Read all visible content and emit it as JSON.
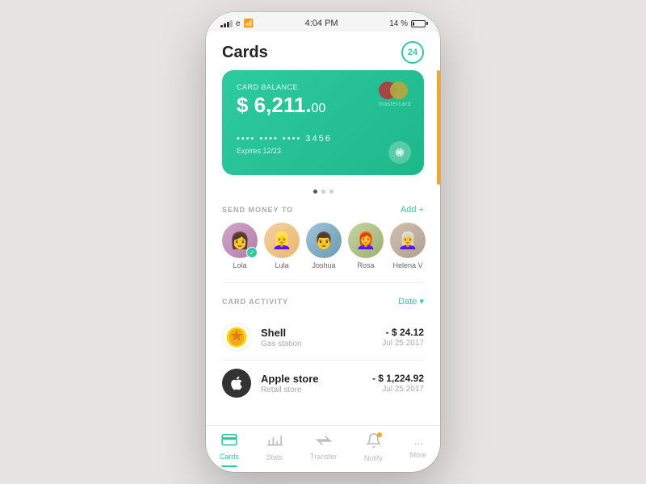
{
  "statusBar": {
    "time": "4:04 PM",
    "battery": "14 %",
    "carrier": "e"
  },
  "header": {
    "title": "Cards",
    "badge": "24"
  },
  "card": {
    "label": "Card balance",
    "balance": "$ 6,211.",
    "cents": "00",
    "cardNumber": "••••  ••••  ••••  3456",
    "expires": "Expires 12/23",
    "mastercardLabel": "mastercard"
  },
  "dots": [
    "active",
    "inactive",
    "inactive"
  ],
  "sendMoney": {
    "title": "SEND MONEY TO",
    "action": "Add +",
    "contacts": [
      {
        "name": "Lola",
        "face": "👩",
        "hasCheck": true
      },
      {
        "name": "Lula",
        "face": "👱‍♀️",
        "hasCheck": false
      },
      {
        "name": "Joshua",
        "face": "👨",
        "hasCheck": false
      },
      {
        "name": "Rosa",
        "face": "👩‍🦰",
        "hasCheck": false
      },
      {
        "name": "Helena V",
        "face": "👩‍🦳",
        "hasCheck": false
      }
    ]
  },
  "cardActivity": {
    "title": "CARD ACTIVITY",
    "filter": "Date ▾",
    "transactions": [
      {
        "name": "Shell",
        "sub": "Gas station",
        "amount": "- $ 24.12",
        "date": "Jul 25 2017",
        "iconType": "shell"
      },
      {
        "name": "Apple store",
        "sub": "Retail store",
        "amount": "- $ 1,224.92",
        "date": "Jul 25 2017",
        "iconType": "apple"
      }
    ]
  },
  "bottomNav": {
    "items": [
      {
        "label": "Cards",
        "icon": "▤",
        "active": true
      },
      {
        "label": "Stats",
        "icon": "📊",
        "active": false
      },
      {
        "label": "Transfer",
        "icon": "⇄",
        "active": false
      },
      {
        "label": "Notify",
        "icon": "🔔",
        "active": false,
        "hasDot": true
      },
      {
        "label": "More",
        "icon": "···",
        "active": false
      }
    ]
  }
}
